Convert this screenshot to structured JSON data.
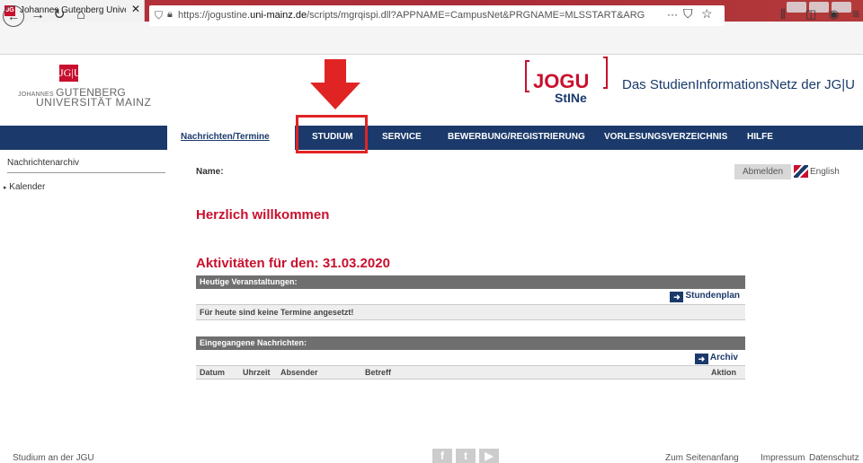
{
  "browser": {
    "tab_title": "Johannes Gutenberg Universitä",
    "tab_favicon": "JG",
    "url_prefix": "https://jogustine.",
    "url_domain": "uni-mainz.de",
    "url_rest": "/scripts/mgrqispi.dll?APPNAME=CampusNet&PRGNAME=MLSSTART&ARGUMENTS=",
    "url_more": "···"
  },
  "header": {
    "logo_mark": "JG|U",
    "logo_line1_small": "JOHANNES",
    "logo_line1_big": "GUTENBERG",
    "logo_line2": "UNIVERSITÄT MAINZ",
    "jogu_logo": "JOGU StINe",
    "site_title": "Das StudienInformationsNetz der JG|U"
  },
  "nav": {
    "items": [
      "Nachrichten/Termine",
      "Studium",
      "Service",
      "Bewerbung/Registrierung",
      "Vorlesungsverzeichnis",
      "Hilfe"
    ]
  },
  "sidebar": {
    "items": [
      "Nachrichtenarchiv",
      "Kalender"
    ]
  },
  "content": {
    "name_label": "Name:",
    "logout": "Abmelden",
    "language": "English",
    "welcome": "Herzlich willkommen",
    "activities_title": "Aktivitäten für den: 31.03.2020",
    "today": {
      "header": "Heutige Veranstaltungen:",
      "link": "Stundenplan",
      "empty_text": "Für heute sind keine Termine angesetzt!"
    },
    "messages": {
      "header": "Eingegangene Nachrichten:",
      "link": "Archiv",
      "columns": [
        "Datum",
        "Uhrzeit",
        "Absender",
        "Betreff",
        "Aktion"
      ]
    }
  },
  "footer": {
    "left": "Studium an der JGU",
    "social": [
      "f",
      "t",
      "▶"
    ],
    "top": "Zum Seitenanfang",
    "imprint": "Impressum",
    "privacy": "Datenschutz"
  },
  "colors": {
    "brand_red": "#c8102e",
    "nav_blue": "#1b3a6b",
    "highlight_red": "#e02424"
  }
}
